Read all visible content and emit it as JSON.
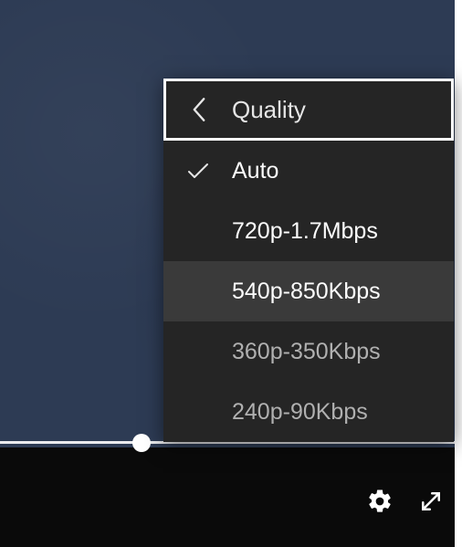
{
  "menu": {
    "title": "Quality",
    "items": [
      {
        "label": "Auto",
        "selected": true,
        "hover": false,
        "bright": true
      },
      {
        "label": "720p-1.7Mbps",
        "selected": false,
        "hover": false,
        "bright": true
      },
      {
        "label": "540p-850Kbps",
        "selected": false,
        "hover": true,
        "bright": true
      },
      {
        "label": "360p-350Kbps",
        "selected": false,
        "hover": false,
        "bright": false
      },
      {
        "label": "240p-90Kbps",
        "selected": false,
        "hover": false,
        "bright": false
      }
    ]
  }
}
